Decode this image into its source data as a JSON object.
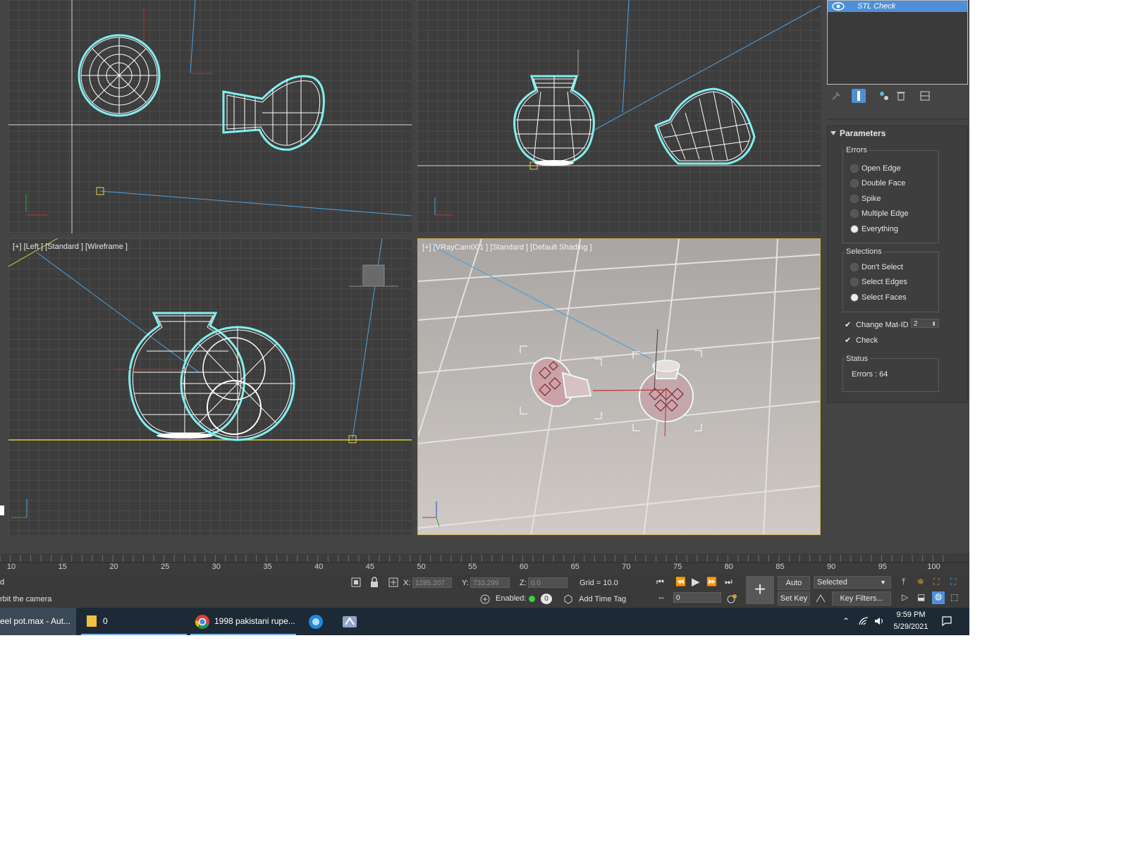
{
  "viewports": {
    "top_left": {
      "label": ""
    },
    "top_right": {
      "label": ""
    },
    "left": {
      "label": "[+] [Left ] [Standard ] [Wireframe ]"
    },
    "camera": {
      "label": "[+] [VRayCam001 ] [Standard ] [Default Shading ]"
    }
  },
  "command_panel": {
    "modifier_stack": {
      "item": "STL Check"
    },
    "rollout": {
      "title": "Parameters",
      "errors_group": {
        "title": "Errors",
        "options": [
          "Open Edge",
          "Double Face",
          "Spike",
          "Multiple Edge",
          "Everything"
        ],
        "selected": "Everything"
      },
      "selections_group": {
        "title": "Selections",
        "options": [
          "Don't Select",
          "Select Edges",
          "Select Faces"
        ],
        "selected": "Select Faces"
      },
      "change_mat_id": {
        "label": "Change Mat-ID",
        "checked": true,
        "value": "2"
      },
      "check": {
        "label": "Check",
        "checked": true
      },
      "status": {
        "title": "Status",
        "text": "Errors : 64"
      }
    }
  },
  "timeline": {
    "ticks": [
      "10",
      "15",
      "20",
      "25",
      "30",
      "35",
      "40",
      "45",
      "50",
      "55",
      "60",
      "65",
      "70",
      "75",
      "80",
      "85",
      "90",
      "95",
      "100"
    ]
  },
  "status_bar": {
    "line1": "d",
    "prompt": "rbit the camera",
    "x_label": "X:",
    "x_value": "1285.207",
    "y_label": "Y:",
    "y_value": "733.299",
    "z_label": "Z:",
    "z_value": "0.0",
    "grid": "Grid = 10.0",
    "enabled_label": "Enabled:",
    "enabled_value": "0",
    "add_time_tag": "Add Time Tag",
    "auto_key": "Auto Key",
    "set_key": "Set Key",
    "selected_dropdown": "Selected",
    "key_filters": "Key Filters...",
    "frame_value": "0"
  },
  "taskbar": {
    "items": [
      {
        "label": "eel pot.max - Aut...",
        "icon": "3dsmax-icon"
      },
      {
        "label": "0",
        "icon": "folder-icon"
      },
      {
        "label": "1998 pakistani rupe...",
        "icon": "chrome-icon"
      },
      {
        "label": "",
        "icon": "browser-icon"
      },
      {
        "label": "",
        "icon": "app-icon"
      }
    ],
    "time": "9:59 PM",
    "date": "5/29/2021"
  },
  "colors": {
    "viewport_bg": "#3d3d3d",
    "grid": "#555555",
    "selection": "#7ff0f0",
    "camera_line": "#4aa3e0",
    "highlight_blue": "#4f8fd6",
    "taskbar_bg": "#1d2a36"
  }
}
